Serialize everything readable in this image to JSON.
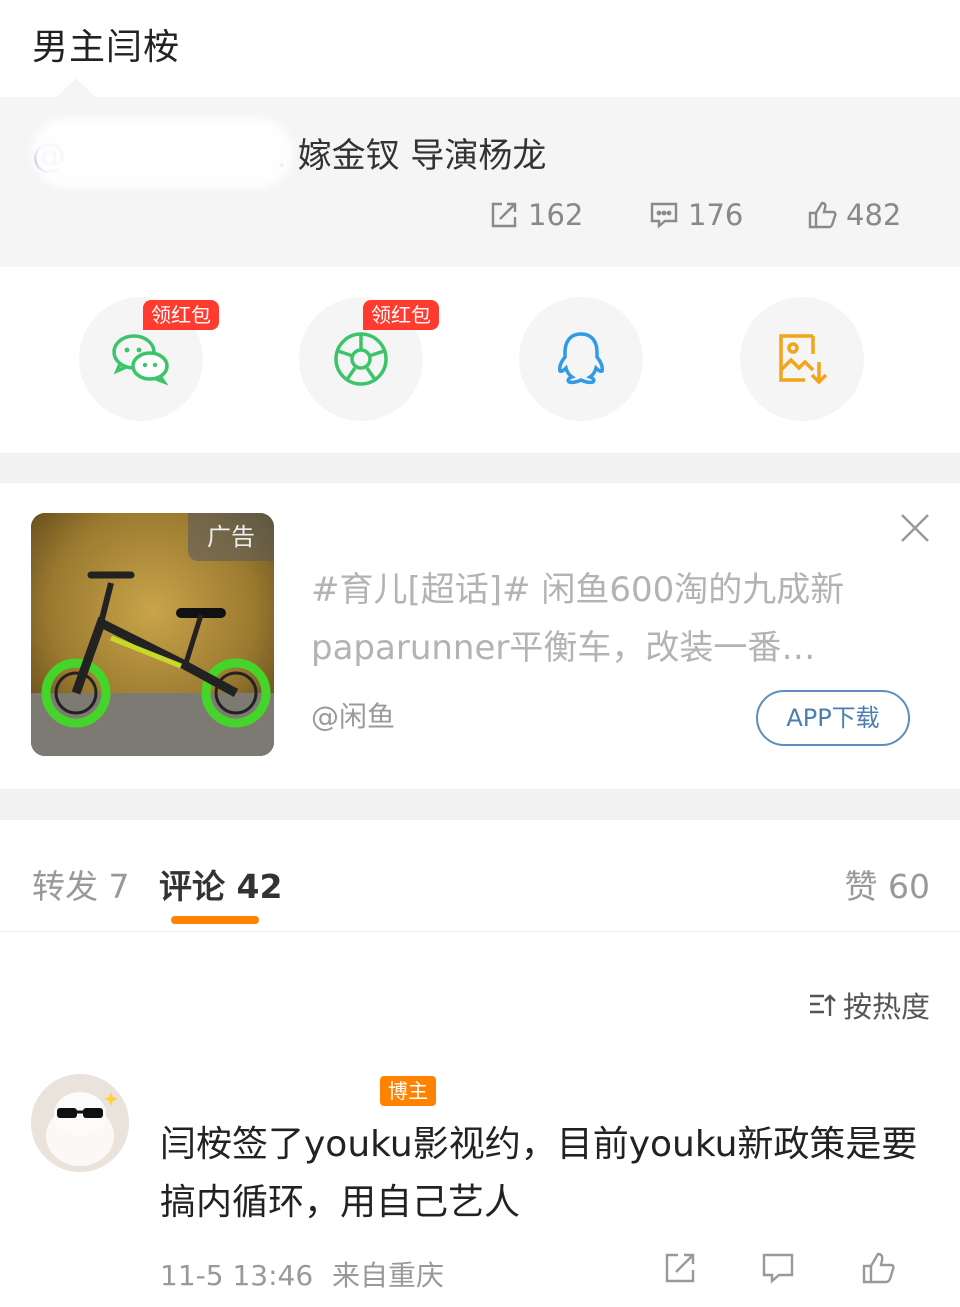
{
  "header": {
    "title": "男主闫桉"
  },
  "quote": {
    "mention_prefix": "@",
    "text_visible": ". 嫁金钗 导演杨龙",
    "stats": {
      "repost": "162",
      "comment": "176",
      "like": "482"
    }
  },
  "share": {
    "items": [
      {
        "name": "wechat",
        "badge": "领红包"
      },
      {
        "name": "moments",
        "badge": "领红包"
      },
      {
        "name": "qq",
        "badge": ""
      },
      {
        "name": "save-image",
        "badge": ""
      }
    ],
    "colors": {
      "wechat": "#3cc46a",
      "moments": "#3cc46a",
      "qq": "#2f9be6",
      "save": "#f2a51a"
    }
  },
  "ad": {
    "tag": "广告",
    "text": "#育儿[超话]# 闲鱼600淘的九成新paparunner平衡车，改装一番…",
    "source": "@闲鱼",
    "cta": "APP下载"
  },
  "tabs": {
    "repost": "转发 7",
    "comment": "评论 42",
    "like": "赞 60",
    "accent": "#ff8200"
  },
  "sort": {
    "label": "按热度"
  },
  "comment": {
    "role_badge": "博主",
    "text": "闫桉签了youku影视约，目前youku新政策是要搞内循环，用自己艺人",
    "time": "11-5 13:46",
    "location": "来自重庆"
  }
}
